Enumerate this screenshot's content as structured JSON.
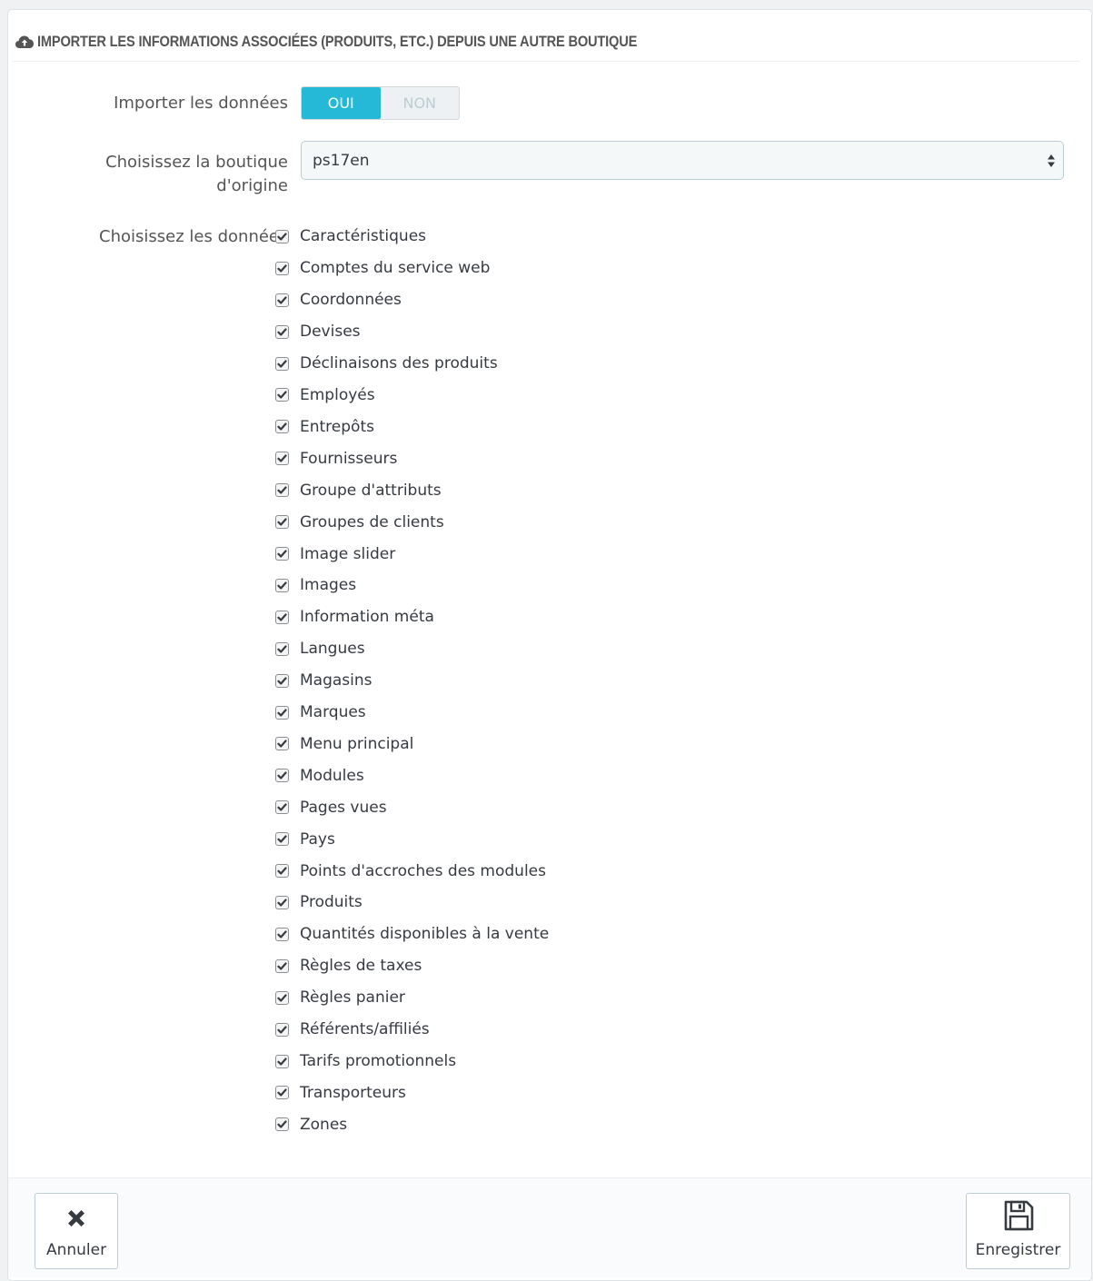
{
  "panel": {
    "title": "IMPORTER LES INFORMATIONS ASSOCIÉES (PRODUITS, ETC.) DEPUIS UNE AUTRE BOUTIQUE",
    "icon": "cloud-upload-icon"
  },
  "import_data": {
    "label": "Importer les données",
    "yes_label": "OUI",
    "no_label": "NON",
    "selected": "OUI"
  },
  "source_shop": {
    "label_line1": "Choisissez la boutique",
    "label_line2": "d'origine",
    "value": "ps17en"
  },
  "data_select": {
    "label": "Choisissez les donnée",
    "items": [
      {
        "label": "Caractéristiques",
        "checked": true
      },
      {
        "label": "Comptes du service web",
        "checked": true
      },
      {
        "label": "Coordonnées",
        "checked": true
      },
      {
        "label": "Devises",
        "checked": true
      },
      {
        "label": "Déclinaisons des produits",
        "checked": true
      },
      {
        "label": "Employés",
        "checked": true
      },
      {
        "label": "Entrepôts",
        "checked": true
      },
      {
        "label": "Fournisseurs",
        "checked": true
      },
      {
        "label": "Groupe d'attributs",
        "checked": true
      },
      {
        "label": "Groupes de clients",
        "checked": true
      },
      {
        "label": "Image slider",
        "checked": true
      },
      {
        "label": "Images",
        "checked": true
      },
      {
        "label": "Information méta",
        "checked": true
      },
      {
        "label": "Langues",
        "checked": true
      },
      {
        "label": "Magasins",
        "checked": true
      },
      {
        "label": "Marques",
        "checked": true
      },
      {
        "label": "Menu principal",
        "checked": true
      },
      {
        "label": "Modules",
        "checked": true
      },
      {
        "label": "Pages vues",
        "checked": true
      },
      {
        "label": "Pays",
        "checked": true
      },
      {
        "label": "Points d'accroches des modules",
        "checked": true
      },
      {
        "label": "Produits",
        "checked": true
      },
      {
        "label": "Quantités disponibles à la vente",
        "checked": true
      },
      {
        "label": "Règles de taxes",
        "checked": true
      },
      {
        "label": "Règles panier",
        "checked": true
      },
      {
        "label": "Référents/affiliés",
        "checked": true
      },
      {
        "label": "Tarifs promotionnels",
        "checked": true
      },
      {
        "label": "Transporteurs",
        "checked": true
      },
      {
        "label": "Zones",
        "checked": true
      }
    ]
  },
  "footer": {
    "cancel_label": "Annuler",
    "save_label": "Enregistrer"
  },
  "colors": {
    "accent": "#25b9d7",
    "text": "#363a41",
    "label": "#555555"
  }
}
